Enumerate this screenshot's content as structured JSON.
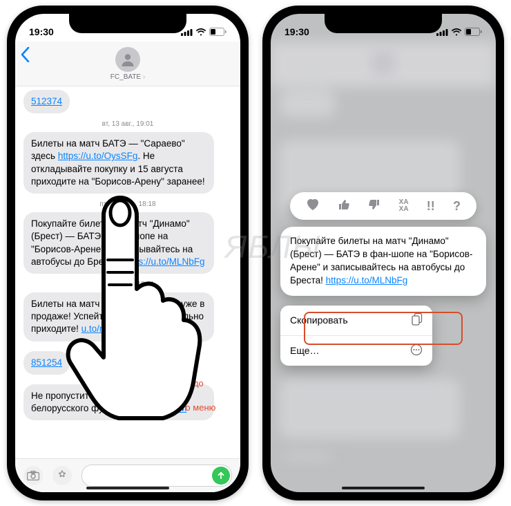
{
  "status": {
    "time": "19:30"
  },
  "contact": "FC_BATE",
  "msgs": {
    "m1": {
      "text": "512374"
    },
    "ts1": "вт, 13 авг., 19:01",
    "m2": {
      "pre": "Билеты на матч БАТЭ — \"Сараево\" здесь ",
      "link": "https://u.to/OysSFg",
      "post": ". Не откладывайте покупку и 15 августа приходите на \"Борисов-Арену\" заранее!"
    },
    "ts2": "пт, 20 сент., 18:18",
    "m3": {
      "pre": "Покупайте билеты на матч \"Динамо\" (Брест) — БАТЭ в фан-шопе на \"Борисов-Арене\" и записывайтесь на автобусы до Бреста! ",
      "link": "https://u.to/MLNbFg"
    },
    "ts3": "сб, 19 окт., 18:01",
    "m4": {
      "pre": "Билеты на матч БАТЭ — \"Гомель\" уже в продаже! Успейте купить и обязательно приходите! ",
      "link": "u.to/r6d9Fg"
    },
    "m5": {
      "text": "851254"
    },
    "m6": {
      "pre": "Не пропустите главное дерби белорусского футбола! ",
      "link": "https://tinyurl"
    }
  },
  "hint": "Нажмите и удерживайте до появления контекстного меню",
  "focusMsg": {
    "pre": "Покупайте билеты на матч \"Динамо\" (Брест) — БАТЭ в фан-шопе на \"Борисов-Арене\" и записывайтесь на автобусы до Бреста! ",
    "link": "https://u.to/MLNbFg"
  },
  "tapback": {
    "haha": "ХА\nХА"
  },
  "menu": {
    "copy": "Скопировать",
    "more": "Еще…"
  },
  "watermark": "ЯБЛЫ"
}
